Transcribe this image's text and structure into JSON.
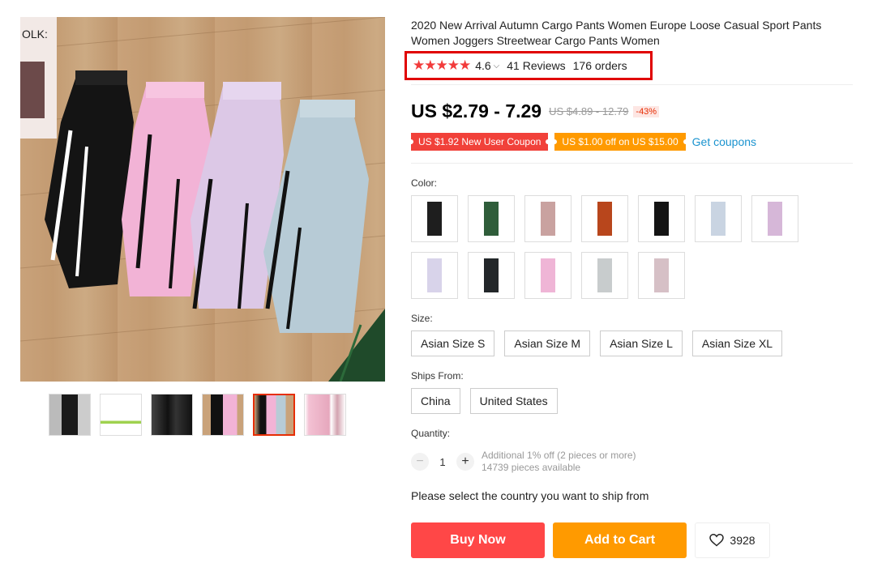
{
  "product": {
    "title": "2020 New Arrival Autumn Cargo Pants Women Europe Loose Casual Sport Pants Women Joggers Streetwear Cargo Pants Women",
    "stars": "★★★★★",
    "rating": "4.6",
    "reviews": "41 Reviews",
    "orders": "176 orders"
  },
  "price": {
    "current": "US $2.79 - 7.29",
    "original": "US $4.89 - 12.79",
    "discount": "-43%"
  },
  "coupons": {
    "new_user": "US $1.92 New User Coupon",
    "off": "US $1.00 off on US $15.00",
    "get_link": "Get coupons"
  },
  "color": {
    "label": "Color:",
    "swatches": [
      {
        "name": "black",
        "color": "#1e1e1e"
      },
      {
        "name": "dark-green",
        "color": "#2f5d3a"
      },
      {
        "name": "dusty-pink",
        "color": "#c9a2a0"
      },
      {
        "name": "rust",
        "color": "#b8461c"
      },
      {
        "name": "black-2",
        "color": "#141414"
      },
      {
        "name": "light-blue",
        "color": "#c9d4e2"
      },
      {
        "name": "lilac",
        "color": "#d6b7d8"
      },
      {
        "name": "lavender",
        "color": "#d8d3ea"
      },
      {
        "name": "black-3",
        "color": "#23272a"
      },
      {
        "name": "pink",
        "color": "#efb5d6"
      },
      {
        "name": "silver",
        "color": "#c8cccd"
      },
      {
        "name": "mauve",
        "color": "#d6c0c6"
      }
    ]
  },
  "size": {
    "label": "Size:",
    "options": [
      "Asian Size S",
      "Asian Size M",
      "Asian Size L",
      "Asian Size XL"
    ]
  },
  "ships_from": {
    "label": "Ships From:",
    "options": [
      "China",
      "United States"
    ]
  },
  "quantity": {
    "label": "Quantity:",
    "value": "1",
    "minus": "−",
    "plus": "+",
    "note1": "Additional 1% off (2 pieces or more)",
    "note2": "14739 pieces available"
  },
  "ship_message": "Please select the country you want to ship from",
  "actions": {
    "buy": "Buy Now",
    "cart": "Add to Cart",
    "wishlist_count": "3928"
  },
  "colors": {
    "accent_red": "#ff4747",
    "accent_orange": "#ff9a00",
    "link_blue": "#1a93cf",
    "star_red": "#f23b3b"
  },
  "gallery": {
    "main_image_text": "OLK:",
    "thumbnails": [
      "black-pants-model",
      "size-chart",
      "black-pants-model-2",
      "black-and-pink-pants",
      "four-color-pants-flatlay",
      "pink-pants-detail"
    ],
    "active_thumbnail": 4
  }
}
